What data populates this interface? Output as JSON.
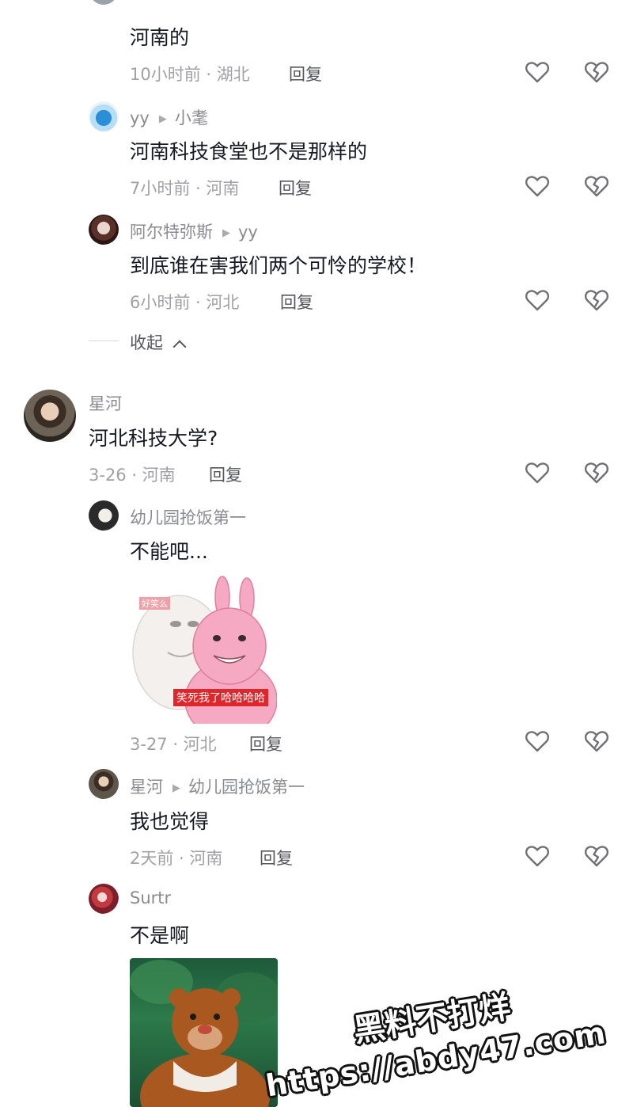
{
  "top_fragment": {
    "text": "河南的",
    "meta": "10小时前 · 湖北",
    "reply": "回复"
  },
  "reply_yy": {
    "user": "yy",
    "reply_to": "小耄",
    "text": "河南科技食堂也不是那样的",
    "meta": "7小时前 · 河南",
    "reply": "回复"
  },
  "reply_artemis": {
    "user": "阿尔特弥斯",
    "reply_to": "yy",
    "text": "到底谁在害我们两个可怜的学校！",
    "meta": "6小时前 · 河北",
    "reply": "回复"
  },
  "collapse": {
    "label": "收起",
    "icon": "chevron-up-icon"
  },
  "comment_xinghe": {
    "user": "星河",
    "text": "河北科技大学?",
    "meta": "3-26 · 河南",
    "reply": "回复"
  },
  "reply_kindergarten": {
    "user": "幼儿园抢饭第一",
    "text": "不能吧...",
    "meta": "3-27 · 河北",
    "reply": "回复",
    "sticker": {
      "corner_tag": "好笑么",
      "caption": "笑死我了哈哈哈哈"
    }
  },
  "reply_xinghe2": {
    "user": "星河",
    "reply_to": "幼儿园抢饭第一",
    "text": "我也觉得",
    "meta": "2天前 · 河南",
    "reply": "回复"
  },
  "reply_surtr": {
    "user": "Surtr",
    "text": "不是啊"
  },
  "watermark": {
    "line1": "黑料不打烊",
    "line2": "https://abdy47.com"
  },
  "icons": {
    "like": "heart-outline-icon",
    "dislike": "broken-heart-icon"
  },
  "colors": {
    "primary_text": "#161823",
    "secondary_text": "#8a8b91",
    "meta_text": "#a0a1a7",
    "sticker_caption_bg": "#e0262b",
    "pink_bunny": "#f6a9c3"
  }
}
